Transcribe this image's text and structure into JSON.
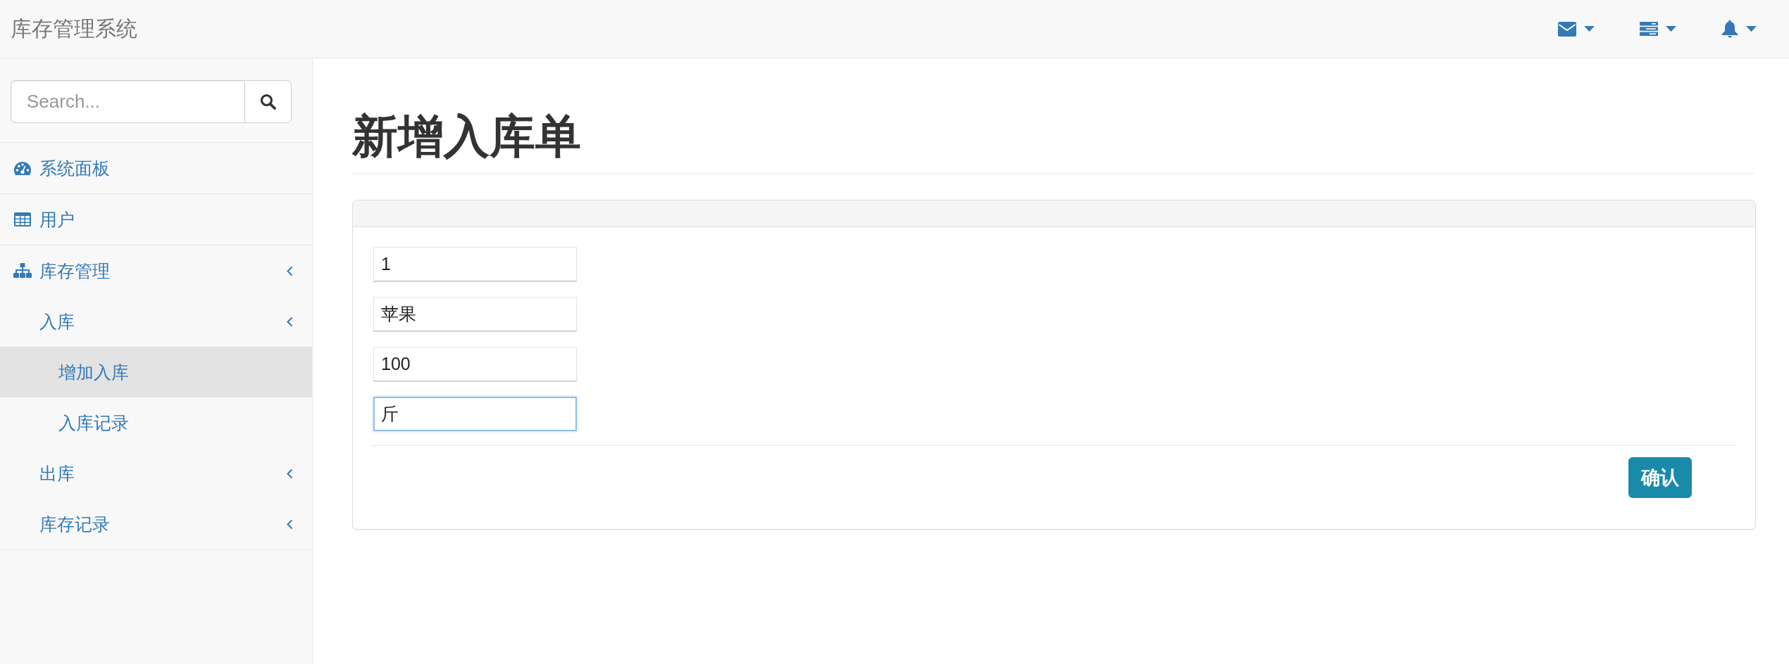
{
  "navbar": {
    "brand": "库存管理系统"
  },
  "sidebar": {
    "search": {
      "placeholder": "Search..."
    },
    "items": [
      {
        "label": "系统面板",
        "submenu": false,
        "selected": false
      },
      {
        "label": "用户",
        "submenu": false,
        "selected": false
      },
      {
        "label": "库存管理",
        "submenu": true,
        "selected": false,
        "children": [
          {
            "label": "入库",
            "submenu": true,
            "selected": false,
            "children": [
              {
                "label": "增加入库",
                "submenu": false,
                "selected": true
              },
              {
                "label": "入库记录",
                "submenu": false,
                "selected": false
              }
            ]
          },
          {
            "label": "出库",
            "submenu": true,
            "selected": false
          },
          {
            "label": "库存记录",
            "submenu": true,
            "selected": false
          }
        ]
      }
    ]
  },
  "page": {
    "title": "新增入库单",
    "form": {
      "fields": [
        {
          "value": "1",
          "focused": false
        },
        {
          "value": "苹果",
          "focused": false
        },
        {
          "value": "100",
          "focused": false
        },
        {
          "value": "斤",
          "focused": true
        }
      ],
      "submit": "确认"
    }
  }
}
